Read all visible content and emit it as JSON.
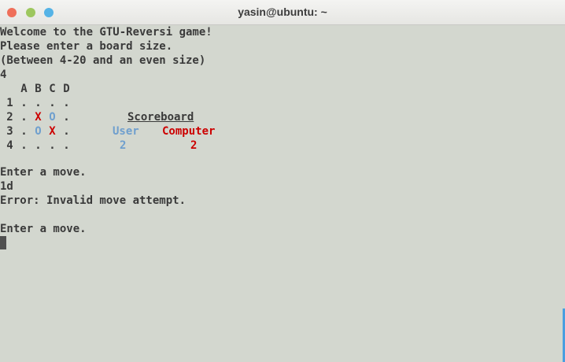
{
  "window": {
    "title": "yasin@ubuntu: ~"
  },
  "terminal": {
    "intro": [
      "Welcome to the GTU-Reversi game!",
      "Please enter a board size.",
      "(Between 4-20 and an even size)",
      "4"
    ],
    "board": {
      "columns": [
        "A",
        "B",
        "C",
        "D"
      ],
      "rows": [
        {
          "label": "1",
          "cells": [
            ".",
            ".",
            ".",
            "."
          ]
        },
        {
          "label": "2",
          "cells": [
            ".",
            "X",
            "O",
            "."
          ]
        },
        {
          "label": "3",
          "cells": [
            ".",
            "O",
            "X",
            "."
          ]
        },
        {
          "label": "4",
          "cells": [
            ".",
            ".",
            ".",
            "."
          ]
        }
      ]
    },
    "scoreboard": {
      "title": "Scoreboard",
      "user_label": "User",
      "computer_label": "Computer",
      "user_score": "2",
      "computer_score": "2"
    },
    "log": [
      "Enter a move.",
      "1d",
      "Error: Invalid move attempt.",
      "Enter a move."
    ]
  },
  "colors": {
    "x_piece": "#cc0000",
    "o_piece": "#6f9fce",
    "text": "#3a3a3a",
    "background": "#d3d7cf"
  }
}
